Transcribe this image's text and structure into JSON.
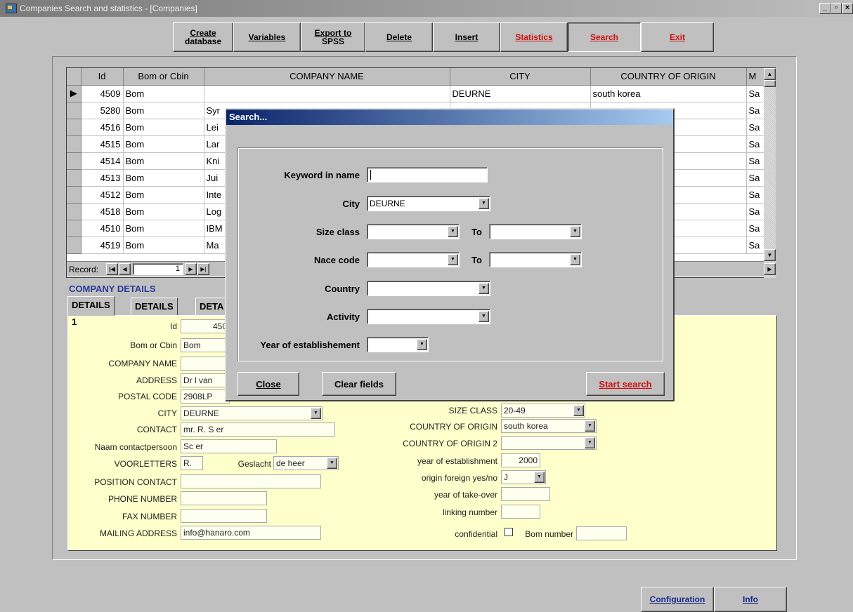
{
  "window": {
    "title": "Companies Search and statistics - [Companies]",
    "min": "_",
    "max": "▫",
    "close": "×"
  },
  "toolbar": {
    "create_line1": "Create",
    "create_line2": "database",
    "variables": "Variables",
    "export_line1": "Export to",
    "export_line2": "SPSS",
    "delete": "Delete",
    "insert": "Insert",
    "statistics": "Statistics",
    "search": "Search",
    "exit": "Exit"
  },
  "grid": {
    "headers": [
      "Id",
      "Bom or Cbin",
      "COMPANY NAME",
      "CITY",
      "COUNTRY OF ORIGIN",
      "M"
    ],
    "rows": [
      {
        "id": "4509",
        "type": "Bom",
        "name": "",
        "city": "DEURNE",
        "country": "south korea",
        "m": "Sa"
      },
      {
        "id": "5280",
        "type": "Bom",
        "name": "Syr",
        "city": "",
        "country": "",
        "m": "Sa"
      },
      {
        "id": "4516",
        "type": "Bom",
        "name": "Lei",
        "city": "",
        "country": "",
        "m": "Sa"
      },
      {
        "id": "4515",
        "type": "Bom",
        "name": "Lar",
        "city": "",
        "country": "",
        "m": "Sa"
      },
      {
        "id": "4514",
        "type": "Bom",
        "name": "Kni",
        "city": "",
        "country": "",
        "m": "Sa"
      },
      {
        "id": "4513",
        "type": "Bom",
        "name": "Jui",
        "city": "",
        "country": "",
        "m": "Sa"
      },
      {
        "id": "4512",
        "type": "Bom",
        "name": "Inte",
        "city": "",
        "country": "",
        "m": "Sa"
      },
      {
        "id": "4518",
        "type": "Bom",
        "name": "Log",
        "city": "",
        "country": "",
        "m": "Sa"
      },
      {
        "id": "4510",
        "type": "Bom",
        "name": "IBM",
        "city": "",
        "country": "",
        "m": "Sa"
      },
      {
        "id": "4519",
        "type": "Bom",
        "name": "Ma",
        "city": "",
        "country": "",
        "m": "Sa"
      }
    ],
    "record_label": "Record:",
    "record_value": "1"
  },
  "details": {
    "section_title": "COMPANY DETAILS",
    "tabs": [
      "DETAILS 1",
      "DETAILS 2",
      "DETA"
    ],
    "left": {
      "id_label": "Id",
      "id_value": "450",
      "bom_label": "Bom or Cbin",
      "bom_value": "Bom",
      "name_label": "COMPANY NAME",
      "name_value": "",
      "address_label": "ADDRESS",
      "address_value": "Dr l    van",
      "postal_label": "POSTAL CODE",
      "postal_value": "2908LP",
      "city_label": "CITY",
      "city_value": "DEURNE",
      "contact_label": "CONTACT",
      "contact_value": "mr. R. S       er",
      "naam_label": "Naam contactpersoon",
      "naam_value": "Sc         er",
      "voorletters_label": "VOORLETTERS",
      "voorletters_value": "R.",
      "geslacht_label": "Geslacht",
      "geslacht_value": "de heer",
      "position_label": "POSITION CONTACT",
      "position_value": "",
      "phone_label": "PHONE NUMBER",
      "phone_value": "",
      "fax_label": "FAX NUMBER",
      "fax_value": "",
      "mail_label": "MAILING ADDRESS",
      "mail_value": "info@hanaro.com"
    },
    "right": {
      "size_label": "SIZE CLASS",
      "size_value": "20-49",
      "origin_label": "COUNTRY OF ORIGIN",
      "origin_value": "south korea",
      "origin2_label": "COUNTRY OF ORIGIN 2",
      "origin2_value": "",
      "year_label": "year of establishment",
      "year_value": "2000",
      "foreign_label": "origin foreign yes/no",
      "foreign_value": "J",
      "takeover_label": "year of take-over",
      "takeover_value": "",
      "linking_label": "linking number",
      "linking_value": "",
      "confidential_label": "confidential",
      "bomnum_label": "Bom number",
      "bomnum_value": ""
    }
  },
  "dialog": {
    "title": "Search...",
    "keyword_label": "Keyword in name",
    "keyword_value": "",
    "city_label": "City",
    "city_value": "DEURNE",
    "size_label": "Size class",
    "size_from": "",
    "size_to": "",
    "nace_label": "Nace code",
    "nace_from": "",
    "nace_to": "",
    "to_label": "To",
    "country_label": "Country",
    "country_value": "",
    "activity_label": "Activity",
    "activity_value": "",
    "year_label": "Year of establishement",
    "year_value": "",
    "close": "Close",
    "clear": "Clear fields",
    "start": "Start search"
  },
  "bottom": {
    "configuration": "Configuration",
    "info": "Info"
  },
  "colors": {
    "accent_red": "#d01010",
    "caption_blue": "#0a246a",
    "details_yellow": "#ffffcc",
    "link_blue": "#2a3a9a"
  }
}
